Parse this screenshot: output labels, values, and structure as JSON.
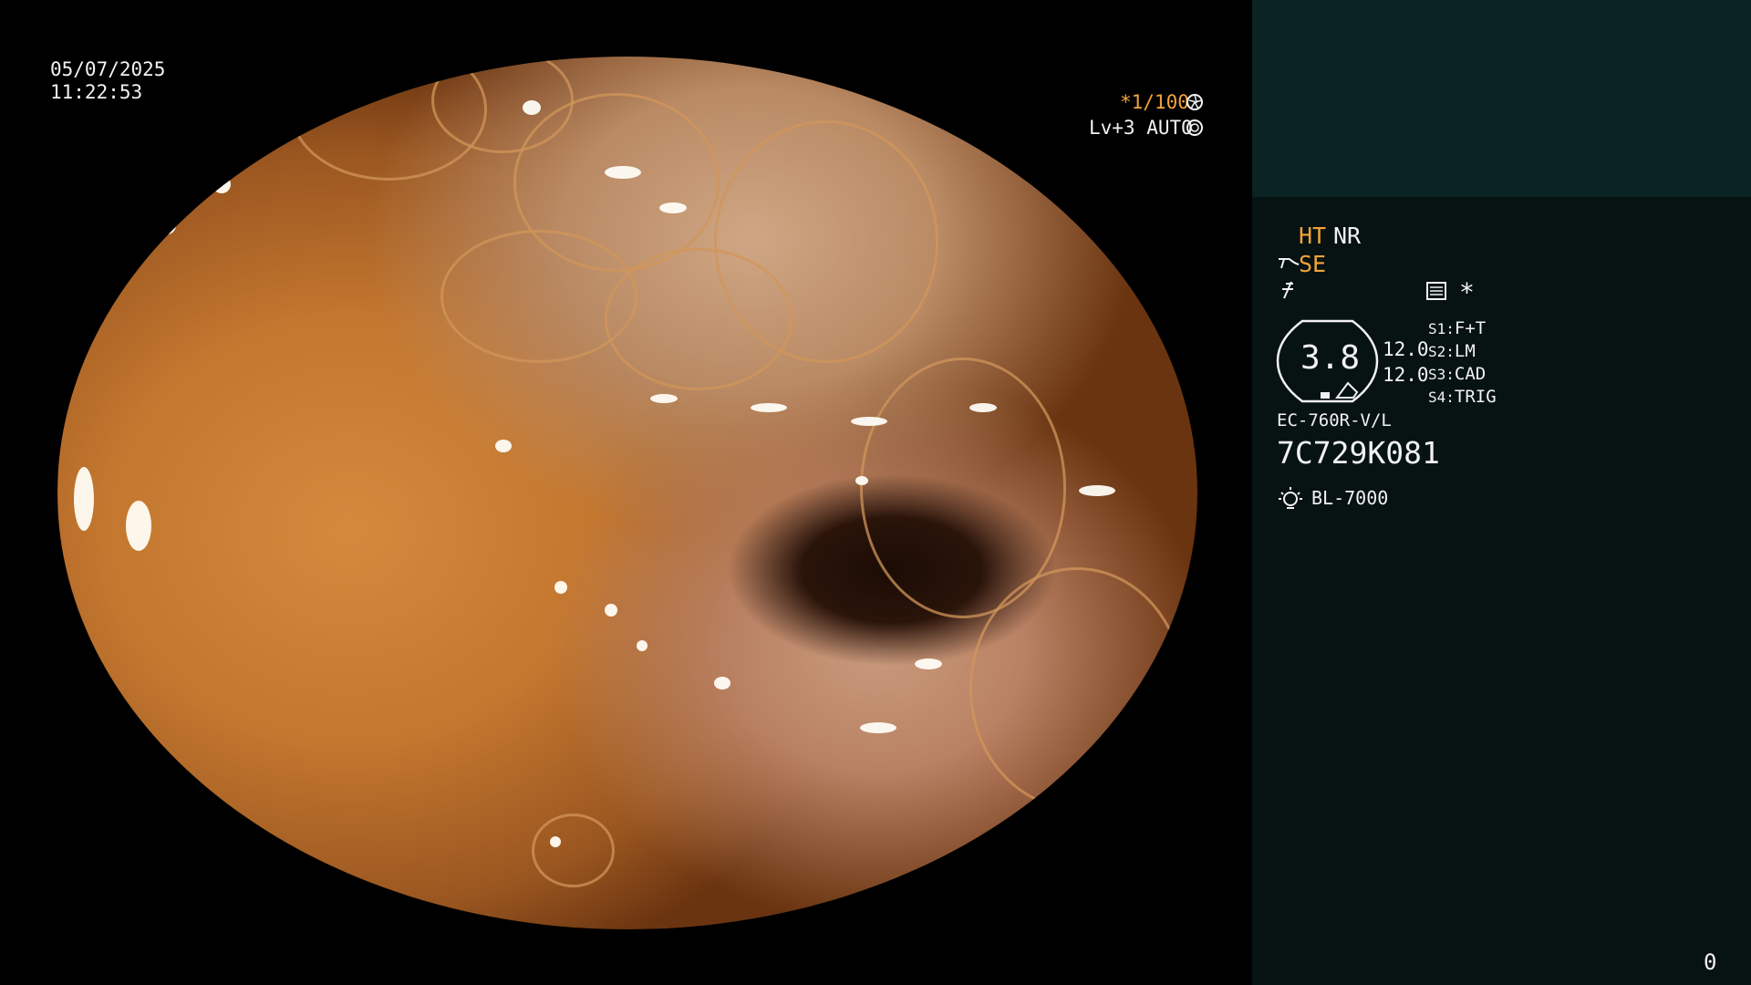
{
  "overlay": {
    "date": "05/07/2025",
    "time": "11:22:53",
    "shutter": "*1/100",
    "iris": "Lv+3 AUTO"
  },
  "panel": {
    "mode_ht": "HT",
    "mode_nr": "NR",
    "mode_se": "SE",
    "asterisk": "*",
    "magnification": "3.8",
    "value_top": "12.0",
    "value_bottom": "12.0",
    "switches": [
      {
        "key": "S1:",
        "value": "F+T"
      },
      {
        "key": "S2:",
        "value": "LM"
      },
      {
        "key": "S3:",
        "value": "CAD"
      },
      {
        "key": "S4:",
        "value": "TRIG"
      }
    ],
    "scope_model": "EC-760R-V/L",
    "serial": "7C729K081",
    "light_source": "BL-7000",
    "counter": "0"
  },
  "colors": {
    "panel_bg": "#071212",
    "panel_top_bg": "#0c2324",
    "accent": "#f2a43a"
  },
  "icons": [
    "iris-icon",
    "auto-iris-icon",
    "se-icon",
    "filter-icon",
    "menu-icon",
    "lamp-icon",
    "scope-head-icon"
  ]
}
